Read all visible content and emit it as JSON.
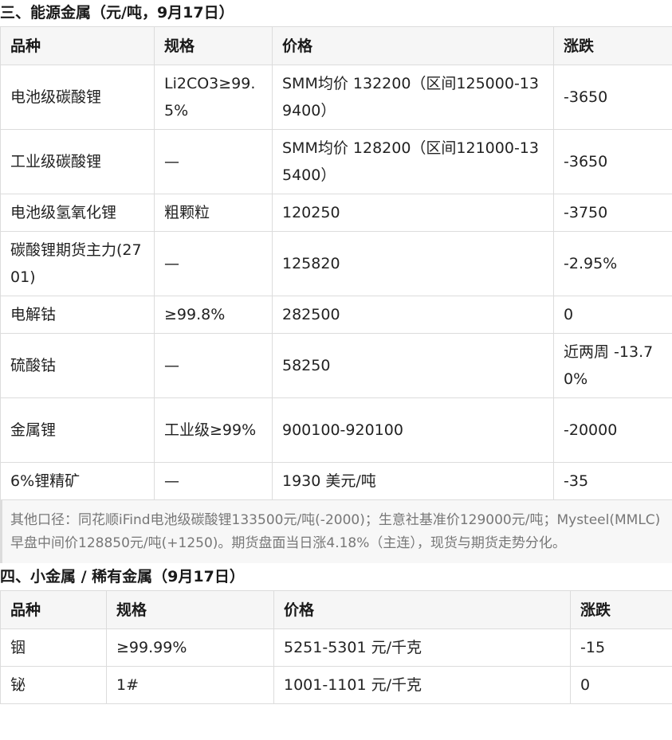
{
  "section3": {
    "title": "三、能源金属（元/吨，9月17日）",
    "headers": [
      "品种",
      "规格",
      "价格",
      "涨跌"
    ],
    "rows": [
      [
        "电池级碳酸锂",
        "Li2CO3≥99.5%",
        "SMM均价 132200（区间125000-139400）",
        "-3650"
      ],
      [
        "工业级碳酸锂",
        "—",
        "SMM均价 128200（区间121000-135400）",
        "-3650"
      ],
      [
        "电池级氢氧化锂",
        "粗颗粒",
        "120250",
        "-3750"
      ],
      [
        "碳酸锂期货主力(2701)",
        "—",
        "125820",
        "-2.95%"
      ],
      [
        "电解钴",
        "≥99.8%",
        "282500",
        "0"
      ],
      [
        "硫酸钴",
        "—",
        "58250",
        "近两周 -13.70%"
      ],
      [
        "金属锂",
        "工业级≥99%",
        "900100-920100",
        "-20000"
      ],
      [
        "6%锂精矿",
        "—",
        "1930 美元/吨",
        "-35"
      ]
    ],
    "note": "其他口径：同花顺iFind电池级碳酸锂133500元/吨(-2000)；生意社基准价129000元/吨；Mysteel(MMLC)早盘中间价128850元/吨(+1250)。期货盘面当日涨4.18%（主连），现货与期货走势分化。"
  },
  "section4": {
    "title": "四、小金属 / 稀有金属（9月17日）",
    "headers": [
      "品种",
      "规格",
      "价格",
      "涨跌"
    ],
    "rows": [
      [
        "铟",
        "≥99.99%",
        "5251-5301 元/千克",
        "-15"
      ],
      [
        "铋",
        "1#",
        "1001-1101 元/千克",
        "0"
      ]
    ]
  }
}
